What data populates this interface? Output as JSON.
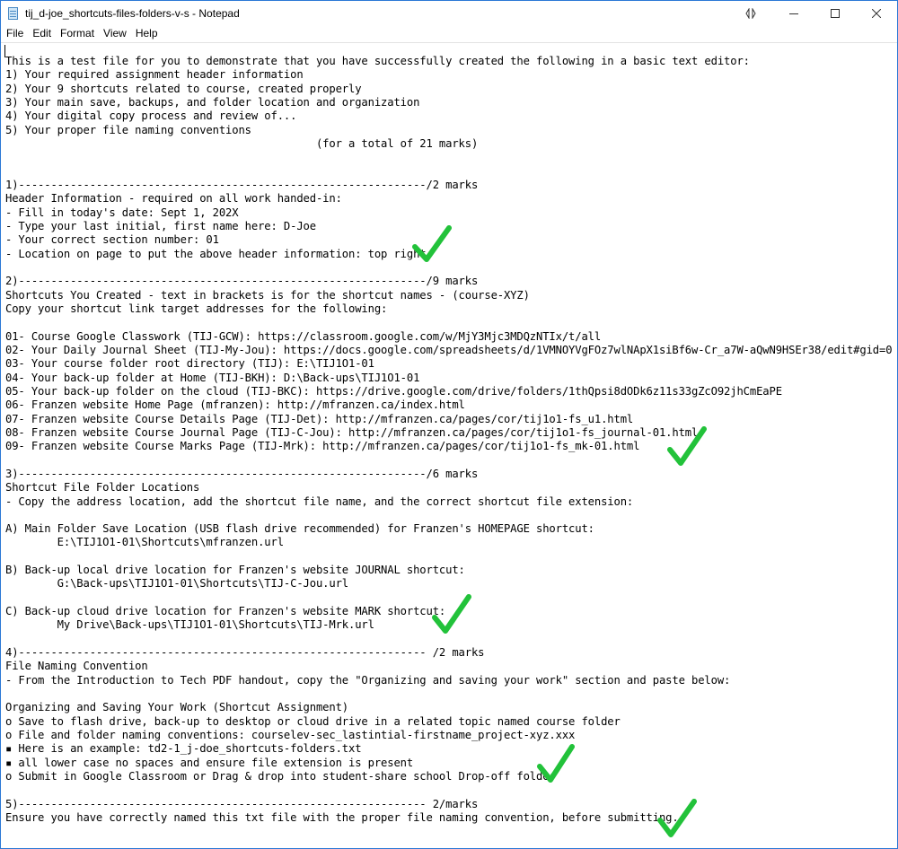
{
  "window": {
    "title": "tij_d-joe_shortcuts-files-folders-v-s - Notepad"
  },
  "menu": [
    "File",
    "Edit",
    "Format",
    "View",
    "Help"
  ],
  "icons": {
    "app": "notepad-icon",
    "controls": [
      "compact-overlay-icon",
      "minimize-icon",
      "maximize-icon",
      "close-icon"
    ],
    "annotation": "checkmark-icon",
    "accent_color": "#22c23a"
  },
  "document": {
    "lines": [
      "This is a test file for you to demonstrate that you have successfully created the following in a basic text editor:",
      "1) Your required assignment header information",
      "2) Your 9 shortcuts related to course, created properly",
      "3) Your main save, backups, and folder location and organization",
      "4) Your digital copy process and review of...",
      "5) Your proper file naming conventions",
      "                                                (for a total of 21 marks)",
      "",
      "",
      "1)---------------------------------------------------------------/2 marks",
      "Header Information - required on all work handed-in:",
      "- Fill in today's date: Sept 1, 202X",
      "- Type your last initial, first name here: D-Joe",
      "- Your correct section number: 01",
      "- Location on page to put the above header information: top right",
      "",
      "2)---------------------------------------------------------------/9 marks",
      "Shortcuts You Created - text in brackets is for the shortcut names - (course-XYZ)",
      "Copy your shortcut link target addresses for the following:",
      "",
      "01- Course Google Classwork (TIJ-GCW): https://classroom.google.com/w/MjY3Mjc3MDQzNTIx/t/all",
      "02- Your Daily Journal Sheet (TIJ-My-Jou): https://docs.google.com/spreadsheets/d/1VMNOYVgFOz7wlNApX1siBf6w-Cr_a7W-aQwN9HSEr38/edit#gid=0",
      "03- Your course folder root directory (TIJ): E:\\TIJ1O1-01",
      "04- Your back-up folder at Home (TIJ-BKH): D:\\Back-ups\\TIJ1O1-01",
      "05- Your back-up folder on the cloud (TIJ-BKC): https://drive.google.com/drive/folders/1thQpsi8dODk6z11s33gZcO92jhCmEaPE",
      "06- Franzen website Home Page (mfranzen): http://mfranzen.ca/index.html",
      "07- Franzen website Course Details Page (TIJ-Det): http://mfranzen.ca/pages/cor/tij1o1-fs_u1.html",
      "08- Franzen website Course Journal Page (TIJ-C-Jou): http://mfranzen.ca/pages/cor/tij1o1-fs_journal-01.html",
      "09- Franzen website Course Marks Page (TIJ-Mrk): http://mfranzen.ca/pages/cor/tij1o1-fs_mk-01.html",
      "",
      "3)---------------------------------------------------------------/6 marks",
      "Shortcut File Folder Locations",
      "- Copy the address location, add the shortcut file name, and the correct shortcut file extension:",
      "",
      "A) Main Folder Save Location (USB flash drive recommended) for Franzen's HOMEPAGE shortcut:",
      "        E:\\TIJ1O1-01\\Shortcuts\\mfranzen.url",
      "",
      "B) Back-up local drive location for Franzen's website JOURNAL shortcut:",
      "        G:\\Back-ups\\TIJ1O1-01\\Shortcuts\\TIJ-C-Jou.url",
      "",
      "C) Back-up cloud drive location for Franzen's website MARK shortcut:",
      "        My Drive\\Back-ups\\TIJ1O1-01\\Shortcuts\\TIJ-Mrk.url",
      "",
      "4)--------------------------------------------------------------- /2 marks",
      "File Naming Convention",
      "- From the Introduction to Tech PDF handout, copy the \"Organizing and saving your work\" section and paste below:",
      "",
      "Organizing and Saving Your Work (Shortcut Assignment)",
      "o Save to flash drive, back-up to desktop or cloud drive in a related topic named course folder",
      "o File and folder naming conventions: courselev-sec_lastintial-firstname_project-xyz.xxx",
      "▪ Here is an example: td2-1_j-doe_shortcuts-folders.txt",
      "▪ all lower case no spaces and ensure file extension is present",
      "o Submit in Google Classroom or Drag & drop into student-share school Drop-off folder",
      "",
      "5)--------------------------------------------------------------- 2/marks",
      "Ensure you have correctly named this txt file with the proper file naming convention, before submitting."
    ]
  }
}
